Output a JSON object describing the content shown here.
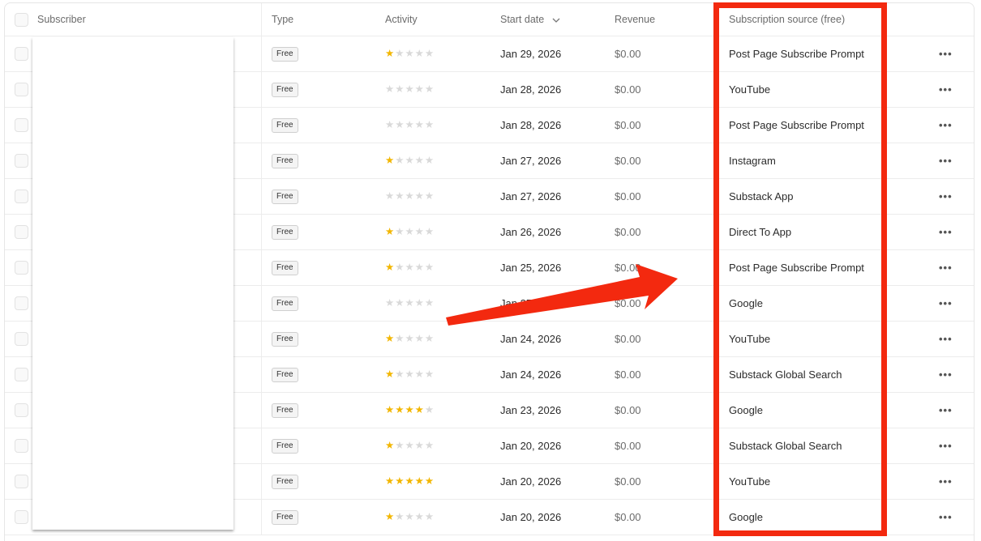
{
  "header": {
    "subscriber": "Subscriber",
    "type": "Type",
    "activity": "Activity",
    "start_date": "Start date",
    "revenue": "Revenue",
    "source": "Subscription source (free)"
  },
  "rows": [
    {
      "type": "Free",
      "activity": 1,
      "start_date": "Jan 29, 2026",
      "revenue": "$0.00",
      "source": "Post Page Subscribe Prompt"
    },
    {
      "type": "Free",
      "activity": 0,
      "start_date": "Jan 28, 2026",
      "revenue": "$0.00",
      "source": "YouTube"
    },
    {
      "type": "Free",
      "activity": 0,
      "start_date": "Jan 28, 2026",
      "revenue": "$0.00",
      "source": "Post Page Subscribe Prompt"
    },
    {
      "type": "Free",
      "activity": 1,
      "start_date": "Jan 27, 2026",
      "revenue": "$0.00",
      "source": "Instagram"
    },
    {
      "type": "Free",
      "activity": 0,
      "start_date": "Jan 27, 2026",
      "revenue": "$0.00",
      "source": "Substack App"
    },
    {
      "type": "Free",
      "activity": 1,
      "start_date": "Jan 26, 2026",
      "revenue": "$0.00",
      "source": "Direct To App"
    },
    {
      "type": "Free",
      "activity": 1,
      "start_date": "Jan 25, 2026",
      "revenue": "$0.00",
      "source": "Post Page Subscribe Prompt"
    },
    {
      "type": "Free",
      "activity": 0,
      "start_date": "Jan 25, 2026",
      "revenue": "$0.00",
      "source": "Google"
    },
    {
      "type": "Free",
      "activity": 1,
      "start_date": "Jan 24, 2026",
      "revenue": "$0.00",
      "source": "YouTube"
    },
    {
      "type": "Free",
      "activity": 1,
      "start_date": "Jan 24, 2026",
      "revenue": "$0.00",
      "source": "Substack Global Search"
    },
    {
      "type": "Free",
      "activity": 4,
      "start_date": "Jan 23, 2026",
      "revenue": "$0.00",
      "source": "Google"
    },
    {
      "type": "Free",
      "activity": 1,
      "start_date": "Jan 20, 2026",
      "revenue": "$0.00",
      "source": "Substack Global Search"
    },
    {
      "type": "Free",
      "activity": 5,
      "start_date": "Jan 20, 2026",
      "revenue": "$0.00",
      "source": "YouTube"
    },
    {
      "type": "Free",
      "activity": 1,
      "start_date": "Jan 20, 2026",
      "revenue": "$0.00",
      "source": "Google"
    }
  ],
  "activity_max": 5,
  "icons": {
    "sort": "chevron-down-icon",
    "more": "more-horizontal-icon",
    "star": "star-icon"
  },
  "colors": {
    "highlight": "#f3290f",
    "star_on": "#f2b600",
    "star_off": "#d9d9d9"
  }
}
